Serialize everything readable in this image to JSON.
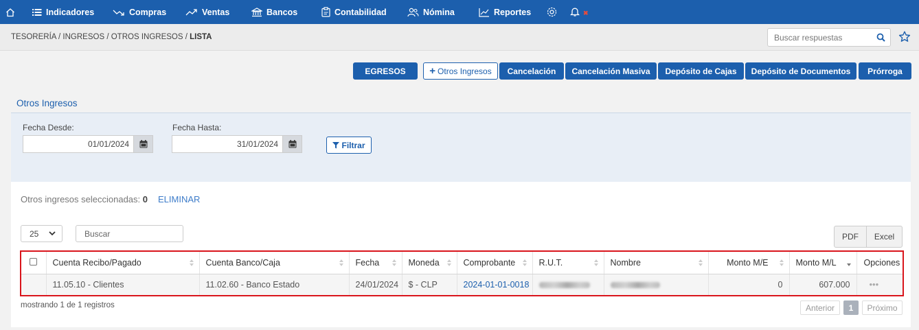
{
  "nav": {
    "items": [
      {
        "label": "Indicadores"
      },
      {
        "label": "Compras"
      },
      {
        "label": "Ventas"
      },
      {
        "label": "Bancos"
      },
      {
        "label": "Contabilidad"
      },
      {
        "label": "Nómina"
      },
      {
        "label": "Reportes"
      }
    ]
  },
  "breadcrumb": {
    "parts": [
      "TESORERÍA",
      "INGRESOS",
      "OTROS INGRESOS"
    ],
    "current": "LISTA",
    "sep": " / "
  },
  "search": {
    "placeholder": "Buscar respuestas"
  },
  "actions": [
    {
      "label": "EGRESOS"
    },
    {
      "label": "Otros Ingresos"
    },
    {
      "label": "Cancelación"
    },
    {
      "label": "Cancelación Masiva"
    },
    {
      "label": "Depósito de Cajas"
    },
    {
      "label": "Depósito de Documentos"
    },
    {
      "label": "Prórroga"
    }
  ],
  "tab": {
    "label": "Otros Ingresos"
  },
  "filters": {
    "desde_label": "Fecha Desde:",
    "desde_value": "01/01/2024",
    "hasta_label": "Fecha Hasta:",
    "hasta_value": "31/01/2024",
    "filtrar_label": "Filtrar"
  },
  "selection": {
    "text": "Otros ingresos seleccionadas:",
    "count": "0",
    "eliminar_label": "ELIMINAR"
  },
  "table_controls": {
    "page_size": "25",
    "search_placeholder": "Buscar",
    "pdf_label": "PDF",
    "excel_label": "Excel"
  },
  "table": {
    "columns": [
      "Cuenta Recibo/Pagado",
      "Cuenta Banco/Caja",
      "Fecha",
      "Moneda",
      "Comprobante",
      "R.U.T.",
      "Nombre",
      "Monto M/E",
      "Monto M/L",
      "Opciones"
    ],
    "rows": [
      {
        "cuenta_recibo": "11.05.10 - Clientes",
        "cuenta_banco": "11.02.60 - Banco Estado",
        "fecha": "24/01/2024",
        "moneda": "$ - CLP",
        "comprobante": "2024-01-01-0018",
        "monto_me": "0",
        "monto_ml": "607.000",
        "opciones": "•••"
      }
    ]
  },
  "footer": {
    "showing": "mostrando 1 de 1 registros",
    "prev_label": "Anterior",
    "current_page": "1",
    "next_label": "Próximo"
  },
  "colors": {
    "primary": "#1c5fad",
    "highlight_border": "#d9141b",
    "notification": "#e74c3c"
  }
}
